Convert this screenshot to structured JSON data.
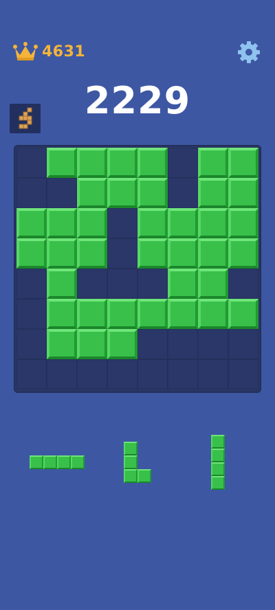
{
  "header": {
    "best_score": "4631",
    "best_icon": "crown-icon",
    "settings_icon": "gear-icon",
    "theme_icon": "wooden-blocks-icon"
  },
  "score": {
    "current": "2229"
  },
  "colors": {
    "background": "#3d57a3",
    "board": "#2a3665",
    "block": "#38c04a",
    "gold": "#f4b43a"
  },
  "board": {
    "size": 8,
    "rows": [
      "01111011",
      "00111011",
      "11101111",
      "11101111",
      "01000110",
      "01111111",
      "01110000",
      "00000000"
    ]
  },
  "tray": {
    "pieces": [
      {
        "name": "horizontal-line-4",
        "cells": [
          [
            0,
            0
          ],
          [
            0,
            1
          ],
          [
            0,
            2
          ],
          [
            0,
            3
          ]
        ]
      },
      {
        "name": "l-shape-3",
        "cells": [
          [
            0,
            0
          ],
          [
            1,
            0
          ],
          [
            2,
            0
          ],
          [
            2,
            1
          ]
        ]
      },
      {
        "name": "vertical-line-4",
        "cells": [
          [
            0,
            0
          ],
          [
            1,
            0
          ],
          [
            2,
            0
          ],
          [
            3,
            0
          ]
        ]
      }
    ]
  }
}
